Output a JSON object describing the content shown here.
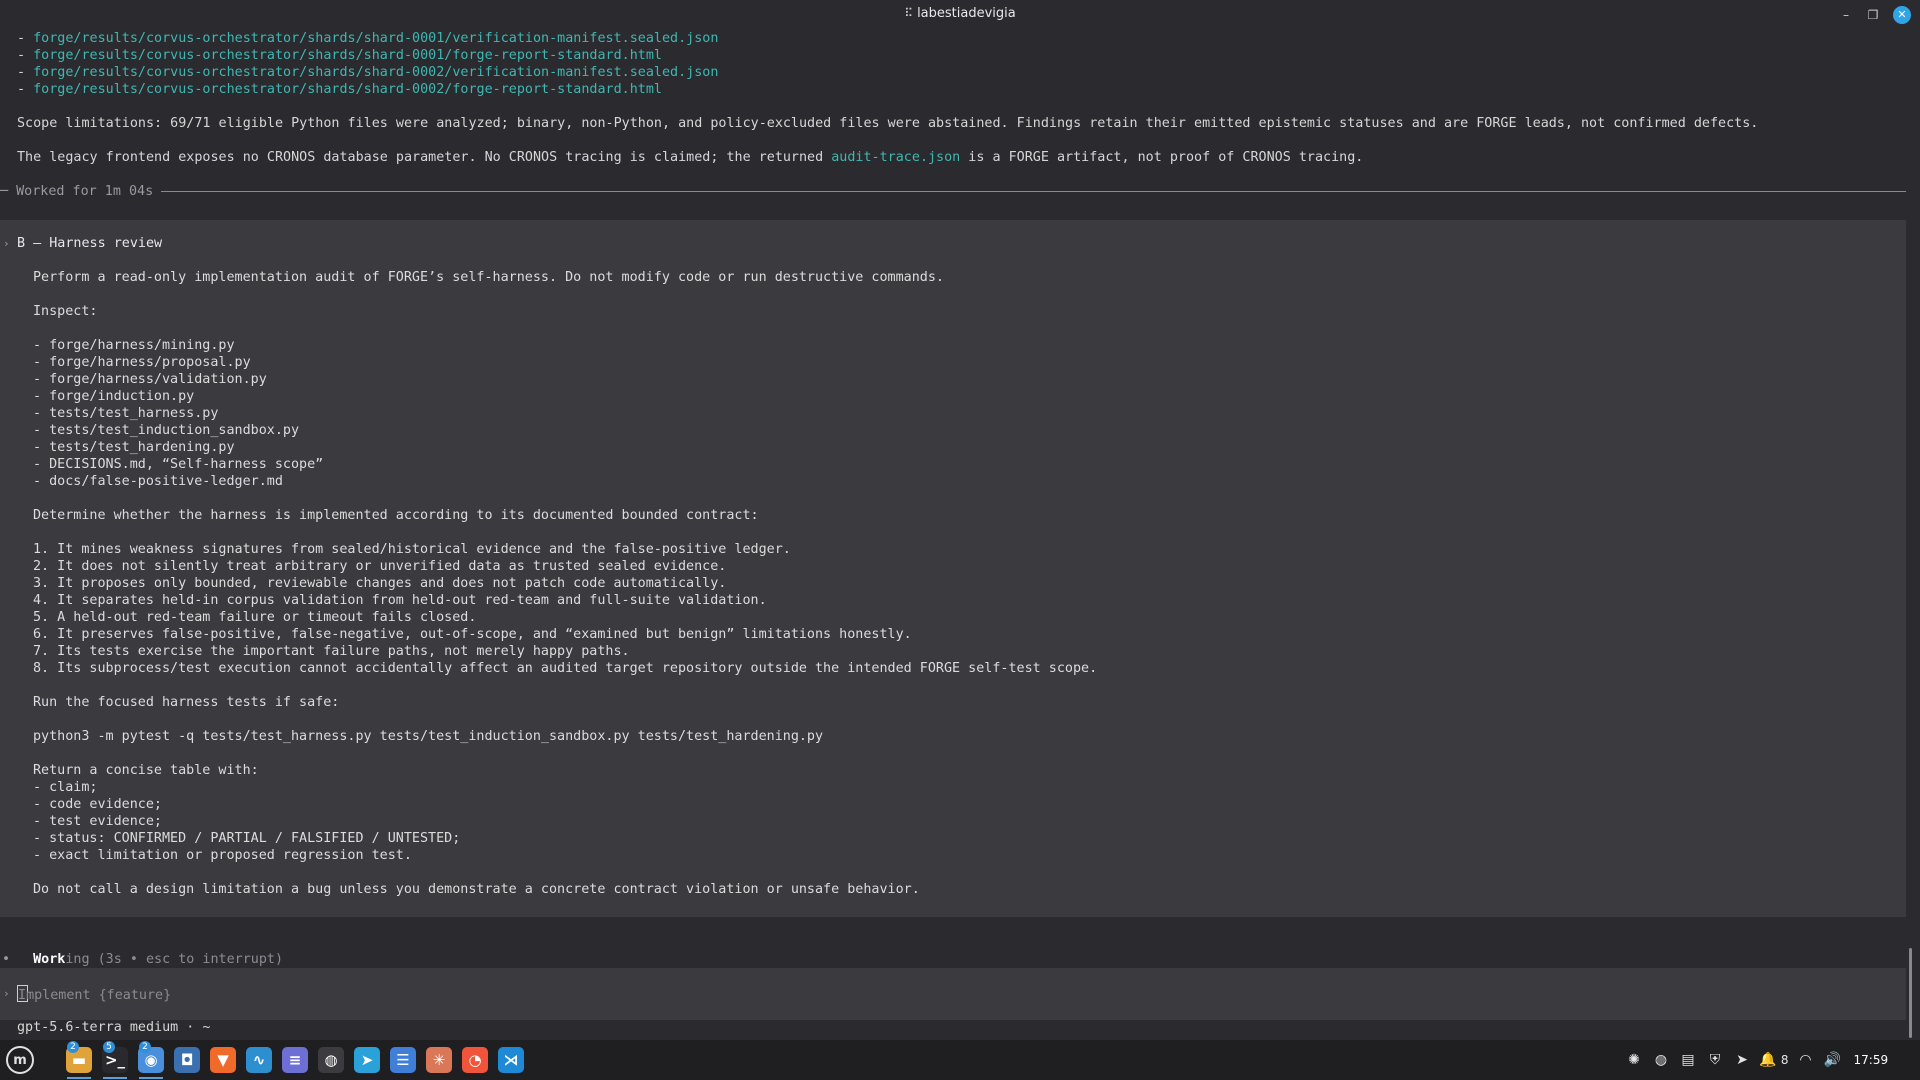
{
  "window": {
    "title": "labestiadevigia",
    "minimize_icon": "minimize-icon",
    "maximize_icon": "maximize-icon",
    "close_icon": "close-icon"
  },
  "output": {
    "files": [
      "forge/results/corvus-orchestrator/shards/shard-0001/verification-manifest.sealed.json",
      "forge/results/corvus-orchestrator/shards/shard-0001/forge-report-standard.html",
      "forge/results/corvus-orchestrator/shards/shard-0002/verification-manifest.sealed.json",
      "forge/results/corvus-orchestrator/shards/shard-0002/forge-report-standard.html"
    ],
    "scope_line": "Scope limitations: 69/71 eligible Python files were analyzed; binary, non-Python, and policy-excluded files were abstained. Findings retain their emitted epistemic statuses and are FORGE leads, not confirmed defects.",
    "legacy_pre": "The legacy frontend exposes no CRONOS database parameter. No CRONOS tracing is claimed; the returned ",
    "legacy_link": "audit-trace.json",
    "legacy_post": " is a FORGE artifact, not proof of CRONOS tracing.",
    "worked_for": "Worked for 1m 04s"
  },
  "prompt": {
    "heading": "B — Harness review",
    "intro": "Perform a read-only implementation audit of FORGE’s self-harness. Do not modify code or run destructive commands.",
    "inspect_label": "Inspect:",
    "inspect_items": [
      "- forge/harness/mining.py",
      "- forge/harness/proposal.py",
      "- forge/harness/validation.py",
      "- forge/induction.py",
      "- tests/test_harness.py",
      "- tests/test_induction_sandbox.py",
      "- tests/test_hardening.py",
      "- DECISIONS.md, “Self-harness scope”",
      "- docs/false-positive-ledger.md"
    ],
    "determine": "Determine whether the harness is implemented according to its documented bounded contract:",
    "contract": [
      "1. It mines weakness signatures from sealed/historical evidence and the false-positive ledger.",
      "2. It does not silently treat arbitrary or unverified data as trusted sealed evidence.",
      "3. It proposes only bounded, reviewable changes and does not patch code automatically.",
      "4. It separates held-in corpus validation from held-out red-team and full-suite validation.",
      "5. A held-out red-team failure or timeout fails closed.",
      "6. It preserves false-positive, false-negative, out-of-scope, and “examined but benign” limitations honestly.",
      "7. Its tests exercise the important failure paths, not merely happy paths.",
      "8. Its subprocess/test execution cannot accidentally affect an audited target repository outside the intended FORGE self-test scope."
    ],
    "run_label": "Run the focused harness tests if safe:",
    "command": "python3 -m pytest -q tests/test_harness.py tests/test_induction_sandbox.py tests/test_hardening.py",
    "return_label": "Return a concise table with:",
    "return_items": [
      "- claim;",
      "- code evidence;",
      "- test evidence;",
      "- status: CONFIRMED / PARTIAL / FALSIFIED / UNTESTED;",
      "- exact limitation or proposed regression test."
    ],
    "closing": "Do not call a design limitation a bug unless you demonstrate a concrete contract violation or unsafe behavior."
  },
  "status": {
    "working_bold": "Work",
    "working_rest": "ing",
    "detail": " (3s • esc to interrupt)"
  },
  "input": {
    "placeholder": "Implement {feature}",
    "first_char": "I",
    "rest": "mplement {feature}"
  },
  "model_line": "gpt-5.6-terra medium · ~",
  "taskbar": {
    "apps": [
      {
        "name": "files",
        "badge": "2",
        "color": "#e0a33a",
        "glyph": "▬"
      },
      {
        "name": "terminal",
        "badge": "5",
        "color": "#2a2a2e",
        "glyph": ">_"
      },
      {
        "name": "chrome",
        "badge": "2",
        "color": "#4a8fdc",
        "glyph": "◉"
      },
      {
        "name": "screenshot",
        "badge": "",
        "color": "#3a6fb0",
        "glyph": "◘"
      },
      {
        "name": "brave",
        "badge": "",
        "color": "#f06a2a",
        "glyph": "▼"
      },
      {
        "name": "monitor",
        "badge": "",
        "color": "#2d8fd0",
        "glyph": "∿"
      },
      {
        "name": "notes",
        "badge": "",
        "color": "#6d6fd4",
        "glyph": "≡"
      },
      {
        "name": "obs",
        "badge": "",
        "color": "#3b3b40",
        "glyph": "◍"
      },
      {
        "name": "telegram",
        "badge": "",
        "color": "#2aa1d8",
        "glyph": "➤"
      },
      {
        "name": "text-editor",
        "badge": "",
        "color": "#3f7fd8",
        "glyph": "☰"
      },
      {
        "name": "claude",
        "badge": "",
        "color": "#d97757",
        "glyph": "✳"
      },
      {
        "name": "firefox-dev",
        "badge": "",
        "color": "#f0543a",
        "glyph": "◔"
      },
      {
        "name": "vscode",
        "badge": "",
        "color": "#1e8ad6",
        "glyph": "⋊"
      }
    ],
    "tray_notify_count": "8",
    "clock": "17:59"
  }
}
